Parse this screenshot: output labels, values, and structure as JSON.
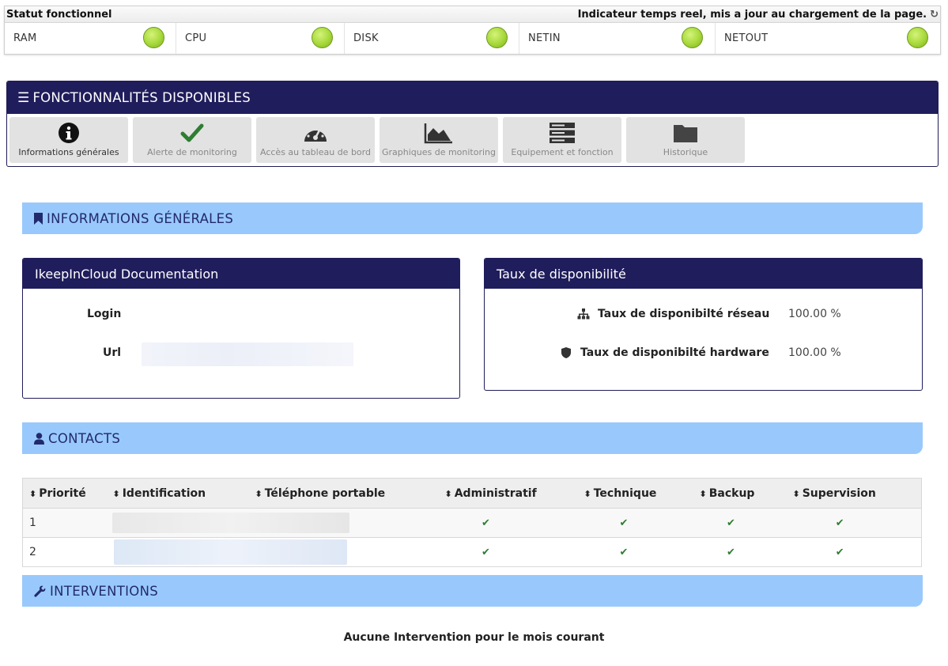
{
  "status": {
    "title": "Statut fonctionnel",
    "indicator": "Indicateur temps reel, mis a jour au chargement de la page.",
    "items": [
      {
        "label": "RAM",
        "state": "ok"
      },
      {
        "label": "CPU",
        "state": "ok"
      },
      {
        "label": "DISK",
        "state": "ok"
      },
      {
        "label": "NETIN",
        "state": "ok"
      },
      {
        "label": "NETOUT",
        "state": "ok"
      }
    ],
    "ok_color": "#a6d83a"
  },
  "features": {
    "title": "FONCTIONNALITÉS DISPONIBLES",
    "tiles": [
      {
        "label": "Informations générales",
        "icon": "info-circle-icon"
      },
      {
        "label": "Alerte de monitoring",
        "icon": "check-icon"
      },
      {
        "label": "Accès au tableau de bord",
        "icon": "dashboard-gauge-icon"
      },
      {
        "label": "Graphiques de monitoring",
        "icon": "area-chart-icon"
      },
      {
        "label": "Equipement et fonction",
        "icon": "server-icon"
      },
      {
        "label": "Historique",
        "icon": "folder-icon"
      }
    ]
  },
  "sections": {
    "info": "INFORMATIONS GÉNÉRALES",
    "contacts": "CONTACTS",
    "interventions": "INTERVENTIONS"
  },
  "doc_card": {
    "title": "IkeepInCloud Documentation",
    "login_label": "Login",
    "url_label": "Url"
  },
  "avail_card": {
    "title": "Taux de disponibilité",
    "network_label": "Taux de disponibilté réseau",
    "network_value": "100.00 %",
    "hardware_label": "Taux de disponibilté hardware",
    "hardware_value": "100.00 %"
  },
  "contacts_table": {
    "columns": [
      "Priorité",
      "Identification",
      "Téléphone portable",
      "Administratif",
      "Technique",
      "Backup",
      "Supervision"
    ],
    "rows": [
      {
        "priority": "1",
        "administratif": true,
        "technique": true,
        "backup": true,
        "supervision": true
      },
      {
        "priority": "2",
        "administratif": true,
        "technique": true,
        "backup": true,
        "supervision": true
      }
    ]
  },
  "interventions": {
    "empty_message": "Aucune Intervention pour le mois courant"
  },
  "colors": {
    "navy": "#201d5c",
    "section_blue": "#99c9fc",
    "check_green": "#2f7d32"
  }
}
